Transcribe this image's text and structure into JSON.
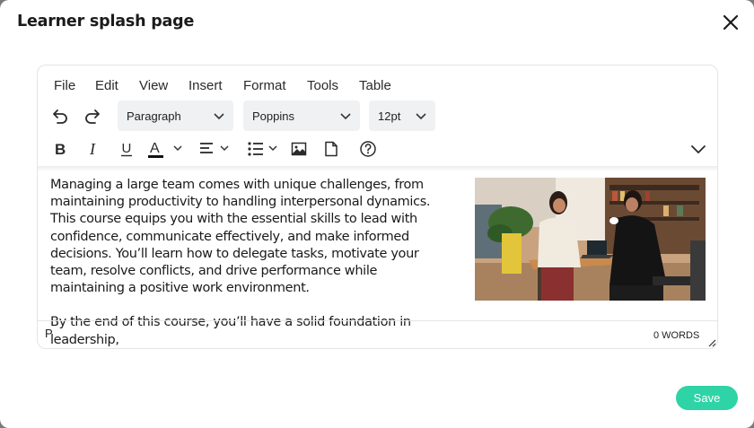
{
  "modal": {
    "title": "Learner splash page",
    "save_label": "Save"
  },
  "menubar": {
    "items": [
      "File",
      "Edit",
      "View",
      "Insert",
      "Format",
      "Tools",
      "Table"
    ]
  },
  "toolbar": {
    "block_format": "Paragraph",
    "font_family": "Poppins",
    "font_size": "12pt",
    "icons": [
      "undo-icon",
      "redo-icon",
      "bold-icon",
      "italic-icon",
      "underline-icon",
      "text-color-icon",
      "align-icon",
      "bullet-list-icon",
      "image-icon",
      "page-icon",
      "help-icon",
      "more-icon"
    ],
    "text_color_underline": "#111111"
  },
  "content": {
    "paragraphs": [
      "Managing a large team comes with unique challenges, from maintaining productivity to handling interpersonal dynamics. This course equips you with the essential skills to lead with confidence, communicate effectively, and make informed decisions. You’ll learn how to delegate tasks, motivate your team, resolve conflicts, and drive performance while maintaining a positive work environment.",
      "By the end of this course, you’ll have a solid foundation in leadership,"
    ]
  },
  "statusbar": {
    "path": "P",
    "word_count": "0 WORDS"
  },
  "colors": {
    "accent": "#2ed3a6",
    "dropdown_bg": "#f0f1f3"
  }
}
